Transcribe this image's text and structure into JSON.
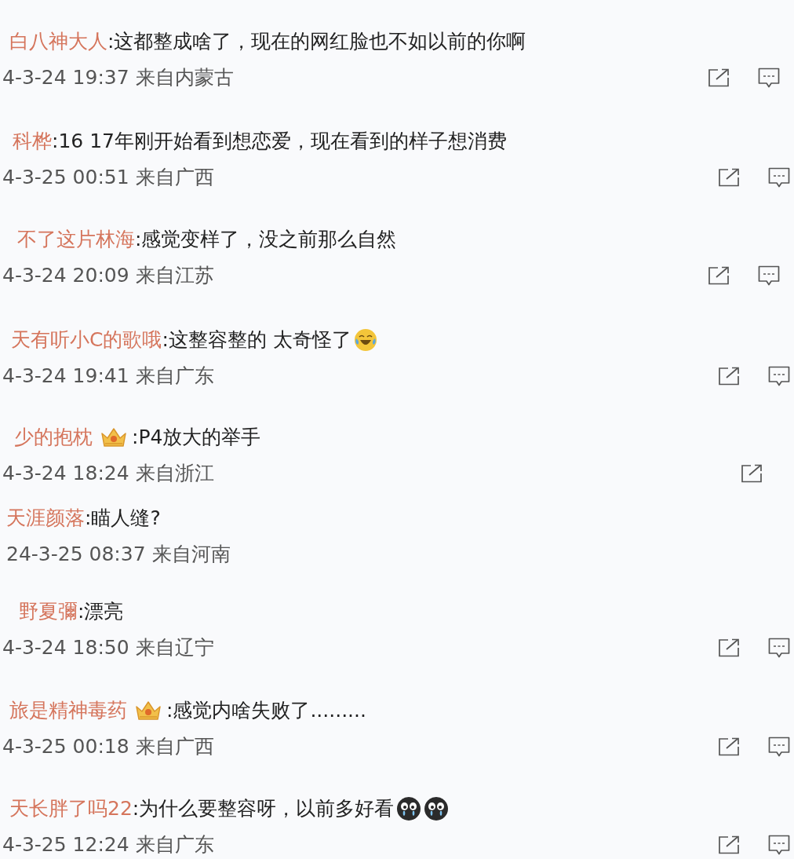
{
  "comments": [
    {
      "user": "白八神大人",
      "badge": false,
      "text": ":这都整成啥了，现在的网红脸也不如以前的你啊",
      "meta": "4-3-24 19:37 来自内蒙古",
      "actions": [
        {
          "kind": "share"
        },
        {
          "kind": "comment"
        }
      ]
    },
    {
      "user": "科桦",
      "badge": false,
      "text": ":16 17年刚开始看到想恋爱，现在看到的样子想消费",
      "meta": "4-3-25 00:51 来自广西",
      "actions": [
        {
          "kind": "share"
        },
        {
          "kind": "comment"
        }
      ]
    },
    {
      "user": "不了这片林海",
      "badge": false,
      "text": ":感觉变样了，没之前那么自然",
      "meta": "4-3-24 20:09 来自江苏",
      "actions": [
        {
          "kind": "share"
        },
        {
          "kind": "comment"
        }
      ]
    },
    {
      "user": "天有听小C的歌哦",
      "badge": false,
      "text": ":这整容整的 太奇怪了",
      "emojis": [
        {
          "kind": "laugh-cry"
        }
      ],
      "meta": "4-3-24 19:41 来自广东",
      "actions": [
        {
          "kind": "share"
        },
        {
          "kind": "comment"
        }
      ]
    },
    {
      "user": "少的抱枕",
      "badge": true,
      "text": ":P4放大的举手",
      "meta": "4-3-24 18:24 来自浙江",
      "actions": [
        {
          "kind": "share"
        }
      ]
    },
    {
      "user": "天涯颜落",
      "badge": false,
      "text": ":瞄人缝?",
      "meta": "24-3-25 08:37 来自河南"
    },
    {
      "user": "野夏彌",
      "badge": false,
      "text": ":漂亮",
      "meta": "4-3-24 18:50 来自辽宁",
      "actions": [
        {
          "kind": "share"
        },
        {
          "kind": "comment"
        }
      ]
    },
    {
      "user": "旅是精神毒药",
      "badge": true,
      "text": ":感觉内啥失败了.........",
      "meta": "4-3-25 00:18 来自广西",
      "actions": [
        {
          "kind": "share"
        },
        {
          "kind": "comment"
        }
      ]
    },
    {
      "user": "天长胖了吗22",
      "badge": false,
      "text": ":为什么要整容呀，以前多好看",
      "emojis": [
        {
          "kind": "crying"
        },
        {
          "kind": "crying"
        }
      ],
      "meta": "4-3-25 12:24 来自广东",
      "actions": [
        {
          "kind": "share"
        },
        {
          "kind": "comment"
        }
      ]
    }
  ]
}
